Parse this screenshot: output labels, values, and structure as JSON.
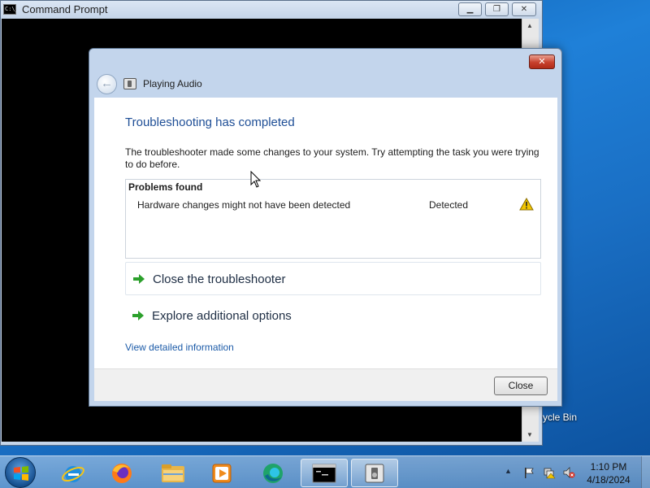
{
  "cmd_window": {
    "title": "Command Prompt",
    "icon": "C:\\_"
  },
  "desktop": {
    "recycle_bin_label": "ycle Bin"
  },
  "dialog": {
    "nav_title": "Playing Audio",
    "heading": "Troubleshooting has completed",
    "message": "The troubleshooter made some changes to your system. Try attempting the task you were trying to do before.",
    "problems": {
      "header": "Problems found",
      "items": [
        {
          "text": "Hardware changes might not have been detected",
          "status": "Detected",
          "icon": "warning-icon"
        }
      ]
    },
    "links": [
      {
        "label": "Close the troubleshooter",
        "icon": "green-arrow-icon"
      },
      {
        "label": "Explore additional options",
        "icon": "green-arrow-icon"
      }
    ],
    "detail_link": "View detailed information",
    "close_button": "Close"
  },
  "taskbar": {
    "apps": [
      "internet-explorer",
      "firefox",
      "file-explorer",
      "media-player",
      "edge",
      "command-prompt",
      "troubleshooter"
    ],
    "clock": {
      "time": "1:10 PM",
      "date": "4/18/2024"
    }
  },
  "colors": {
    "heading": "#1e4e96",
    "link": "#1c5ba8",
    "warning": "#f2c500",
    "arrow": "#2ca02c"
  }
}
